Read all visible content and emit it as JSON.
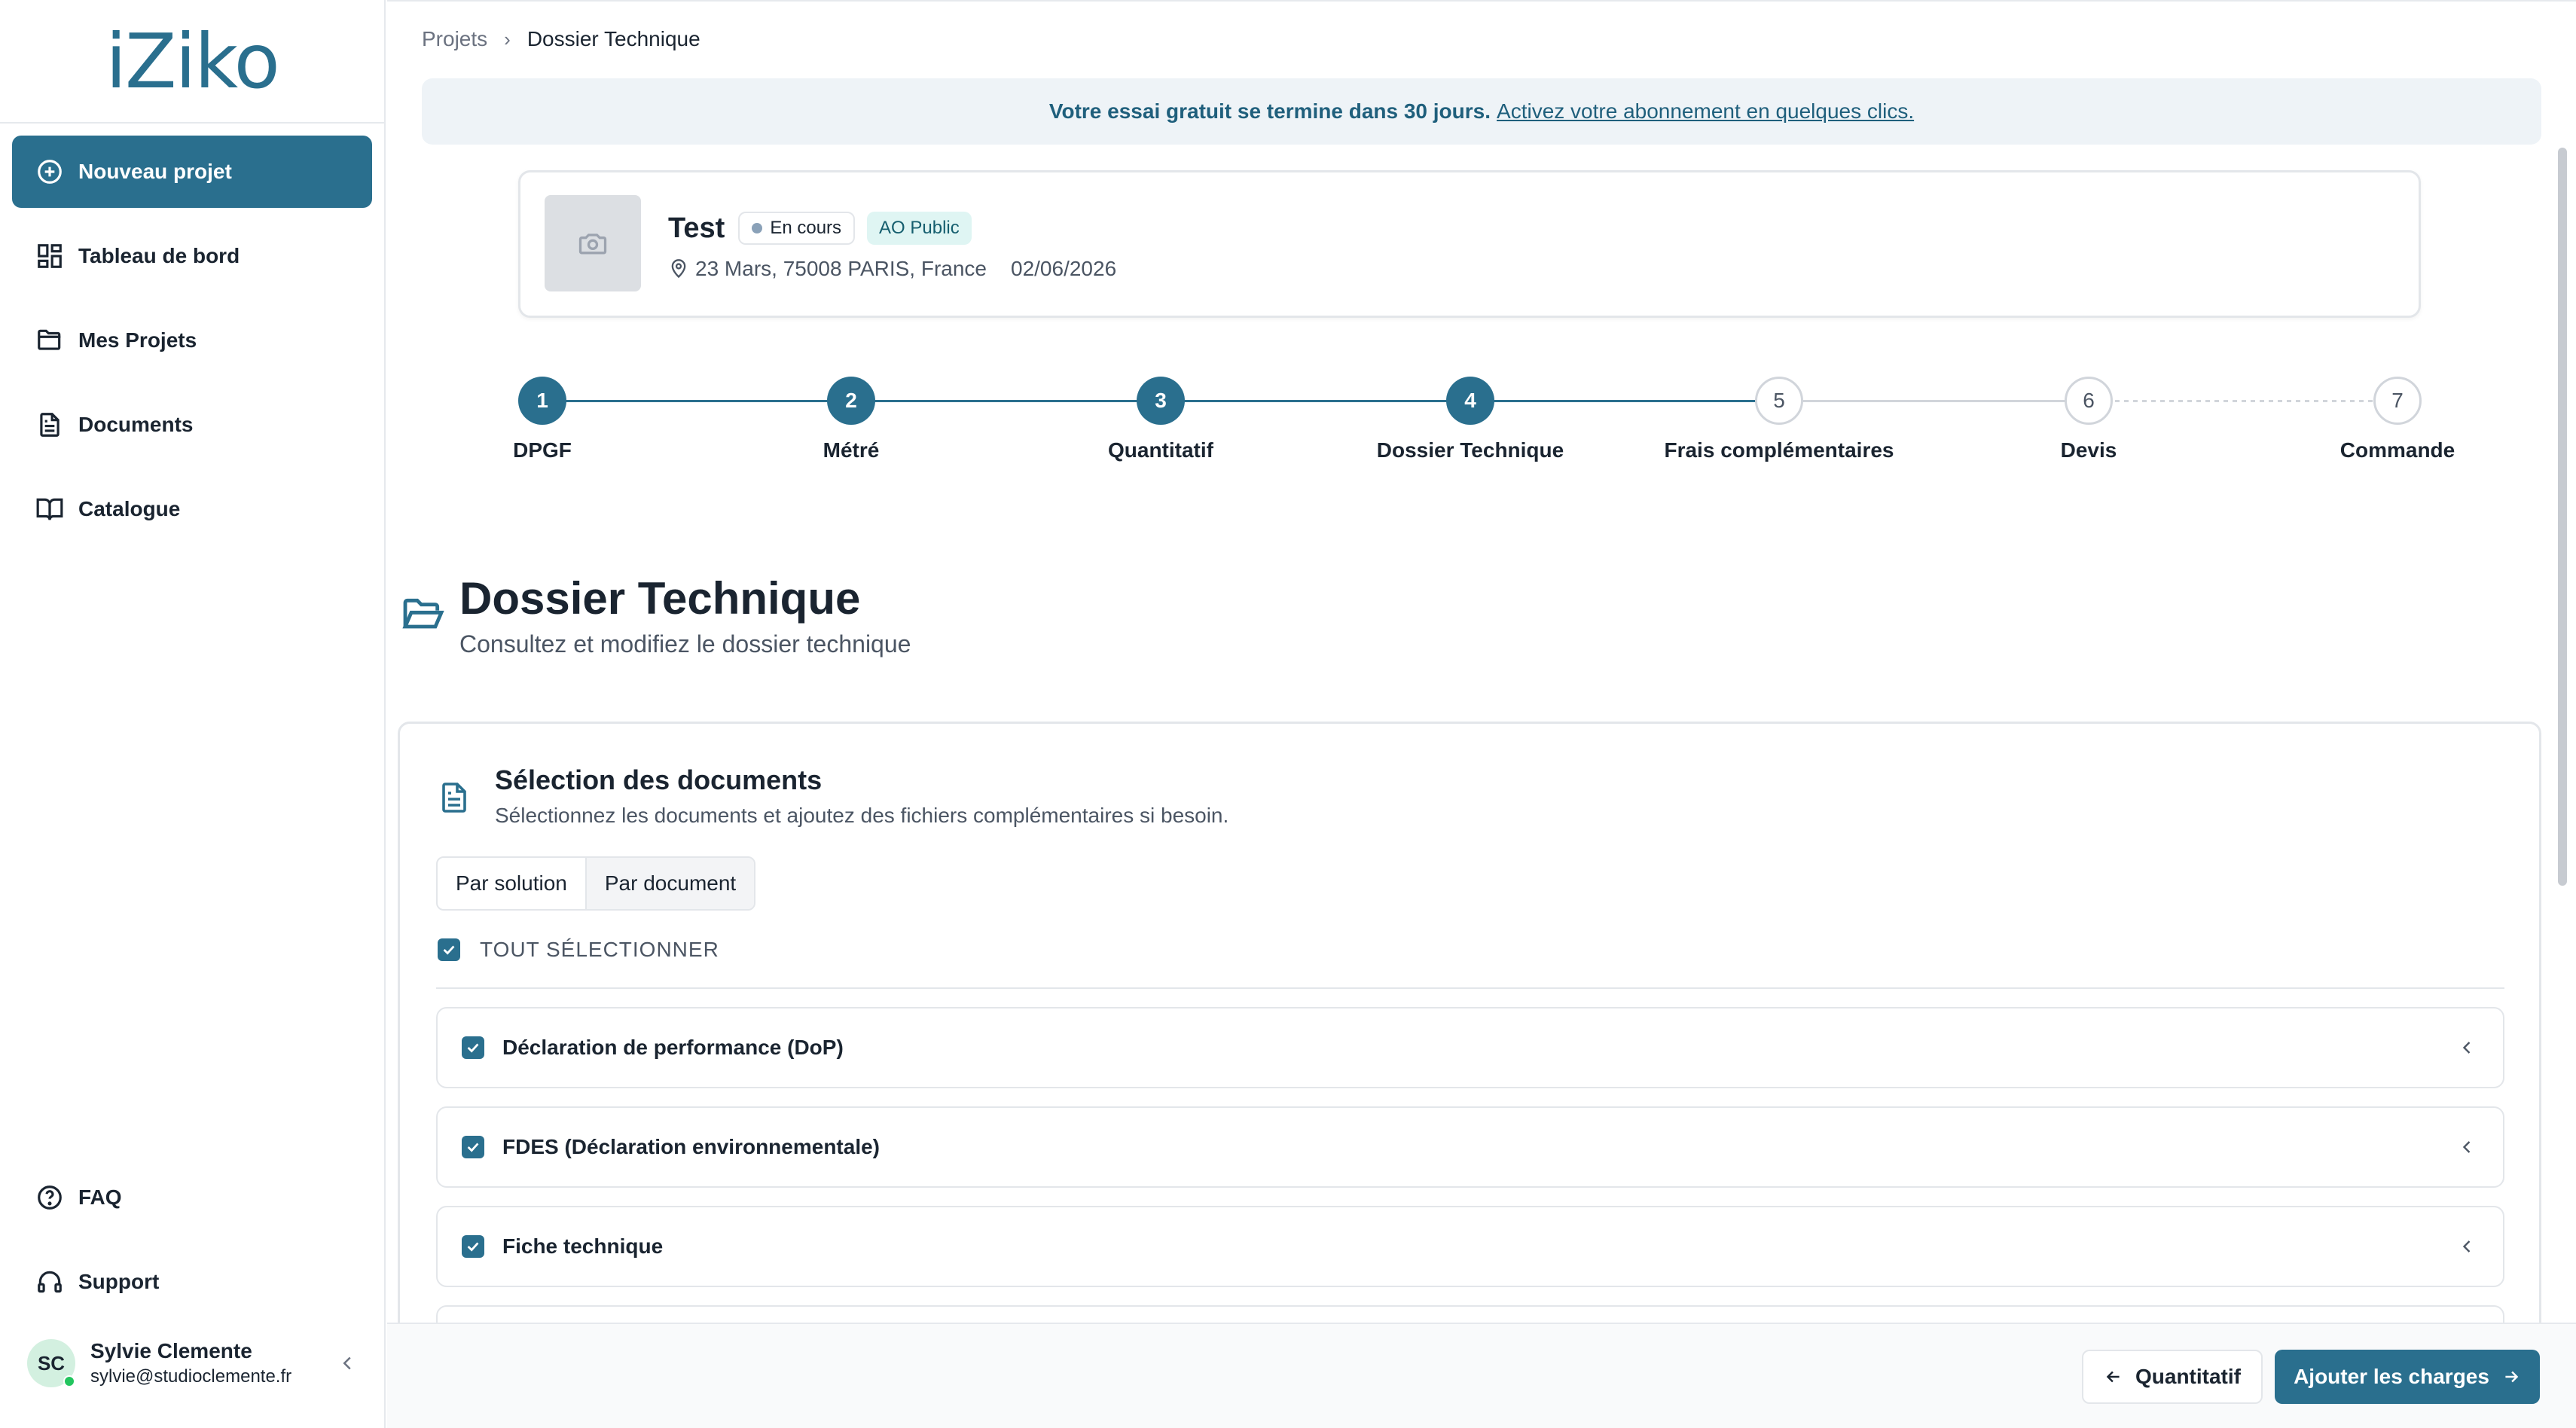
{
  "app": {
    "logo": "iZiko"
  },
  "sidebar": {
    "items": [
      {
        "label": "Nouveau projet",
        "icon": "plus-circle-icon"
      },
      {
        "label": "Tableau de bord",
        "icon": "dashboard-icon"
      },
      {
        "label": "Mes Projets",
        "icon": "folder-icon"
      },
      {
        "label": "Documents",
        "icon": "document-icon"
      },
      {
        "label": "Catalogue",
        "icon": "book-icon"
      }
    ],
    "bottom": [
      {
        "label": "FAQ",
        "icon": "help-circle-icon"
      },
      {
        "label": "Support",
        "icon": "headset-icon"
      }
    ],
    "user": {
      "initials": "SC",
      "name": "Sylvie Clemente",
      "email": "sylvie@studioclemente.fr"
    }
  },
  "breadcrumb": {
    "parent": "Projets",
    "current": "Dossier Technique"
  },
  "trial": {
    "text": "Votre essai gratuit se termine dans 30 jours.",
    "link": "Activez votre abonnement en quelques clics."
  },
  "project": {
    "name": "Test",
    "status": "En cours",
    "type": "AO Public",
    "address": "23 Mars, 75008 PARIS, France",
    "date": "02/06/2026"
  },
  "steps": [
    {
      "num": "1",
      "label": "DPGF",
      "done": true
    },
    {
      "num": "2",
      "label": "Métré",
      "done": true
    },
    {
      "num": "3",
      "label": "Quantitatif",
      "done": true
    },
    {
      "num": "4",
      "label": "Dossier Technique",
      "done": true
    },
    {
      "num": "5",
      "label": "Frais complémentaires",
      "done": false
    },
    {
      "num": "6",
      "label": "Devis",
      "done": false
    },
    {
      "num": "7",
      "label": "Commande",
      "done": false
    }
  ],
  "section": {
    "title": "Dossier Technique",
    "subtitle": "Consultez et modifiez le dossier technique"
  },
  "panel": {
    "title": "Sélection des documents",
    "subtitle": "Sélectionnez les documents et ajoutez des fichiers complémentaires si besoin.",
    "tabs": [
      "Par solution",
      "Par document"
    ],
    "active_tab": "Par document",
    "select_all": "TOUT SÉLECTIONNER",
    "documents": [
      {
        "label": "Déclaration de performance (DoP)",
        "checked": true
      },
      {
        "label": "FDES (Déclaration environnementale)",
        "checked": true
      },
      {
        "label": "Fiche technique",
        "checked": true
      }
    ]
  },
  "footer": {
    "prev_label": "Quantitatif",
    "next_label": "Ajouter les charges"
  },
  "colors": {
    "accent": "#2a6f8e",
    "banner": "#eef3f7",
    "type_badge": "#dff5f3"
  }
}
